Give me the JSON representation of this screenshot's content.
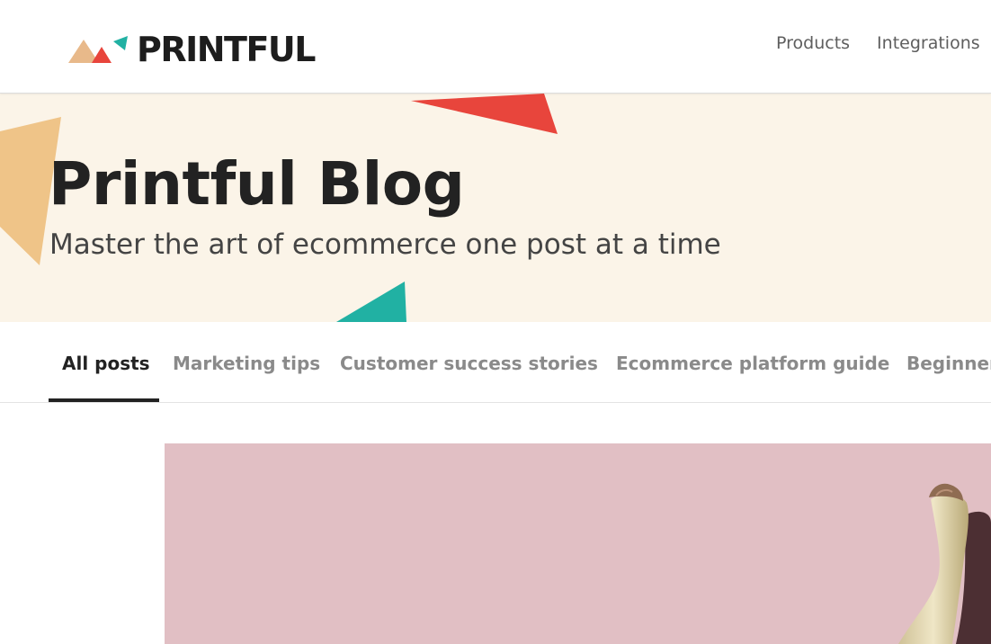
{
  "brand": {
    "name": "PRINTFUL",
    "colors": {
      "orange": "#e8b98a",
      "red": "#e8453c",
      "teal": "#21b1a3",
      "hero_background": "#fbf4e8",
      "text_dark": "#222222"
    }
  },
  "nav": {
    "links": [
      {
        "label": "Products"
      },
      {
        "label": "Integrations"
      }
    ]
  },
  "hero": {
    "title": "Printful Blog",
    "subtitle": "Master the art of ecommerce one post at a time"
  },
  "tabs": [
    {
      "label": "All posts",
      "active": true
    },
    {
      "label": "Marketing tips",
      "active": false
    },
    {
      "label": "Customer success stories",
      "active": false
    },
    {
      "label": "Ecommerce platform guide",
      "active": false
    },
    {
      "label": "Beginner",
      "active": false
    }
  ],
  "featured": {
    "image": "banana-on-pink-background",
    "background_color": "#e1bfc4"
  }
}
